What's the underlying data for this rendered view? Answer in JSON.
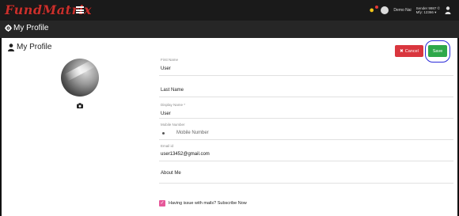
{
  "header": {
    "logo": "FundMatrix",
    "user_name": "Demo Nai",
    "balance_line1": "Sender 9987 ©",
    "balance_line2": "Mfy: 12366 ▾"
  },
  "subheader": {
    "title": "My Profile"
  },
  "card": {
    "title": "My Profile"
  },
  "buttons": {
    "cancel": "Cancel",
    "save": "Save"
  },
  "form": {
    "first_name": {
      "label": "First Name",
      "value": "User"
    },
    "last_name": {
      "placeholder": "Last Name"
    },
    "display_name": {
      "label": "Display Name *",
      "value": "User"
    },
    "mobile": {
      "label": "Mobile Number",
      "placeholder": "Mobile Number"
    },
    "email": {
      "label": "Email id",
      "value": "user13452@gmail.com"
    },
    "about": {
      "placeholder": "About Me"
    }
  },
  "subscribe": {
    "label": "Having issue with mails? Subscribe Now",
    "checked": true
  },
  "colors": {
    "topbar": "#1a1a1a",
    "subbar": "#262626",
    "cancel": "#d9363e",
    "save": "#2ea84a",
    "checkbox": "#e6589a",
    "annotation": "#2a2ad9"
  },
  "icons": {
    "menu": "hamburger-icon",
    "notify": "bulb-icon",
    "gear": "gear-icon",
    "user": "user-icon",
    "camera": "camera-icon"
  }
}
